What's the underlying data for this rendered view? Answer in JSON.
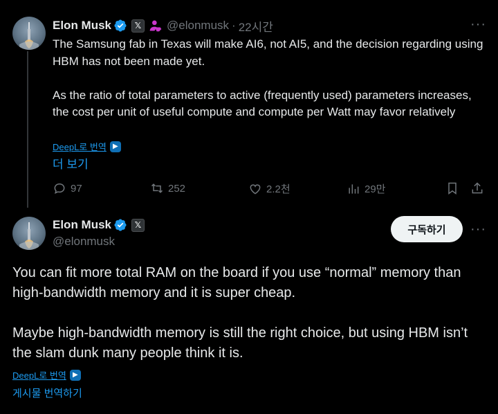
{
  "post1": {
    "author_name": "Elon Musk",
    "x_badge": "𝕏",
    "handle": "@elonmusk",
    "separator": "·",
    "time": "22시간",
    "more": "···",
    "text": "The Samsung fab in Texas will make AI6, not AI5, and the decision regarding using HBM has not been made yet.\n\nAs the ratio of total parameters to active (frequently used) parameters increases, the cost per unit of useful compute and compute per Watt may favor relatively",
    "deepl_label": "DeepL로 번역",
    "show_more": "더 보기",
    "replies": "97",
    "reposts": "252",
    "likes": "2.2천",
    "views": "29만"
  },
  "post2": {
    "author_name": "Elon Musk",
    "x_badge": "𝕏",
    "handle": "@elonmusk",
    "subscribe_label": "구독하기",
    "more": "···",
    "text": "You can fit more total RAM on the board if you use “normal” memory than high-bandwidth memory and it is super cheap.\n\nMaybe high-bandwidth memory is still the right choice, but using HBM isn’t the slam dunk many people think it is.",
    "deepl_label": "DeepL로 번역",
    "translate_post": "게시물 번역하기"
  },
  "colors": {
    "background": "#000000",
    "text": "#e7e9ea",
    "muted": "#71767b",
    "link": "#1d9bf0",
    "verified": "#1d9bf0",
    "affiliate": "#c936cc"
  }
}
